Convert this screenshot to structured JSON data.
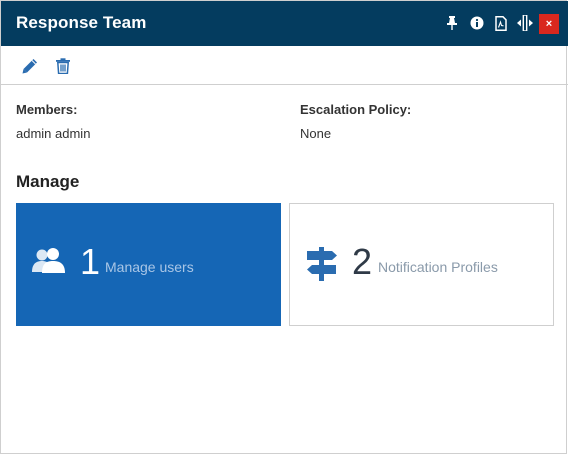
{
  "window": {
    "title": "Response Team",
    "header_icons": [
      "pin-icon",
      "info-icon",
      "pdf-icon",
      "resize-horizontal-icon",
      "close-icon"
    ],
    "close_glyph": "×"
  },
  "toolbar": {
    "icons": [
      "edit-pencil-icon",
      "delete-trash-icon"
    ]
  },
  "details": {
    "members_label": "Members:",
    "members_value": "admin admin",
    "escalation_label": "Escalation Policy:",
    "escalation_value": "None"
  },
  "manage": {
    "title": "Manage",
    "tiles": [
      {
        "count": "1",
        "label": "Manage users",
        "icon": "users-icon",
        "bg": "#1566b5"
      },
      {
        "count": "2",
        "label": "Notification Profiles",
        "icon": "signpost-icon",
        "bg": "#ffffff"
      }
    ]
  },
  "colors": {
    "header_bg": "#043c5f",
    "close_bg": "#d9281e",
    "accent": "#1566b5",
    "icon_blue": "#2a6cb0"
  }
}
